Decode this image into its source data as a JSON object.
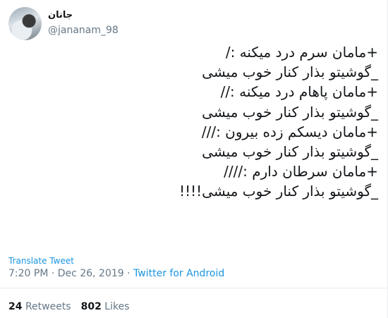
{
  "user": {
    "display_name": "جانان",
    "handle": "@jananam_98"
  },
  "tweet": {
    "lines": [
      "+مامان سرم درد میکنه :/",
      "_گوشیتو بذار کنار خوب میشی",
      "+مامان پاهام درد میکنه ://",
      "_گوشیتو بذار کنار خوب میشی",
      "+مامان دیسکم زده بیرون :///",
      "_گوشیتو بذار کنار خوب میشی",
      "+مامان سرطان دارم :////",
      "_گوشیتو بذار کنار خوب میشی!!!!"
    ]
  },
  "translate_label": "Translate Tweet",
  "meta": {
    "time": "7:20 PM",
    "separator": "·",
    "date": "Dec 26, 2019",
    "source": "Twitter for Android"
  },
  "stats": {
    "retweets_count": "24",
    "retweets_label": "Retweets",
    "likes_count": "802",
    "likes_label": "Likes"
  },
  "colors": {
    "link": "#1b95e0",
    "secondary_text": "#657786",
    "primary_text": "#14171a"
  }
}
